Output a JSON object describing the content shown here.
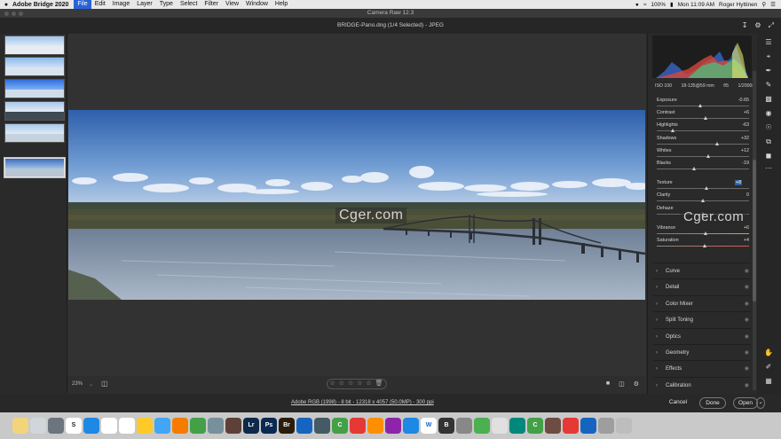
{
  "menubar": {
    "app_name": "Adobe Bridge 2020",
    "menus": [
      "File",
      "Edit",
      "Image",
      "Layer",
      "Type",
      "Select",
      "Filter",
      "View",
      "Window",
      "Help"
    ],
    "battery": "100%",
    "clock": "Mon 11:09 AM",
    "user": "Roger Hyttinen"
  },
  "window": {
    "title": "Camera Raw 12.3"
  },
  "document": {
    "header": "BRIDGE-Pano.dng  (1/4 Selected)  -  JPEG"
  },
  "filmstrip": {
    "count": 5,
    "selected_index": 4
  },
  "watermark": "Cger.com",
  "bottombar": {
    "zoom": "23%",
    "stars": "☆ ☆ ☆ ☆ ☆  🗑"
  },
  "footer": {
    "file_info": "Adobe RGB (1998) - 8 bit - 12318 x 4057 (50.0MP) - 300 ppi",
    "cancel": "Cancel",
    "done": "Done",
    "open": "Open"
  },
  "camera_info": {
    "iso": "ISO 100",
    "lens": "18-135@59 mm",
    "aperture": "f/5",
    "shutter": "1/2000s"
  },
  "sliders": [
    {
      "label": "Exposure",
      "value": "-0.65",
      "pos": 0.48
    },
    {
      "label": "Contrast",
      "value": "+6",
      "pos": 0.53
    },
    {
      "label": "Highlights",
      "value": "-63",
      "pos": 0.18
    },
    {
      "label": "Shadows",
      "value": "+32",
      "pos": 0.66
    },
    {
      "label": "Whites",
      "value": "+12",
      "pos": 0.56
    },
    {
      "label": "Blacks",
      "value": "-19",
      "pos": 0.41
    },
    {
      "label": "Texture",
      "value": "+8",
      "pos": 0.54,
      "boxed": true
    },
    {
      "label": "Clarity",
      "value": "0",
      "pos": 0.5
    },
    {
      "label": "Dehaze",
      "value": "",
      "pos": 0.5
    },
    {
      "label": "Vibrance",
      "value": "+6",
      "pos": 0.53
    },
    {
      "label": "Saturation",
      "value": "+4",
      "pos": 0.52
    }
  ],
  "sections": [
    "Curve",
    "Detail",
    "Color Mixer",
    "Split Toning",
    "Optics",
    "Geometry",
    "Effects",
    "Calibration"
  ],
  "colors": {
    "accent": "#2f5fa8",
    "panel_bg": "#2a2a2a",
    "canvas_bg": "#323232"
  }
}
